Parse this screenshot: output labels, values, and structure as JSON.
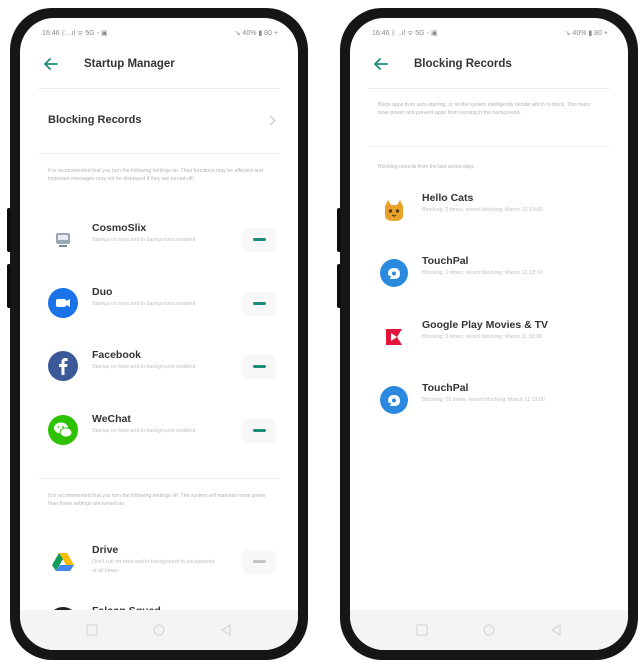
{
  "statusbar": {
    "left_text": "16:46 ᛒ ..ıl ᯤ 5G ◦ ▣",
    "right_text": "↘ 40% ▮ 80 +"
  },
  "left_screen": {
    "title": "Startup Manager",
    "blocking_records_label": "Blocking Records",
    "note_top": "It is recommended that you turn the following settings on. Their functions may be affected and important messages may not be displayed if they are turned off.",
    "apps_on": [
      {
        "name": "CosmoSlix",
        "desc": "Startup on boot and in background enabled"
      },
      {
        "name": "Duo",
        "desc": "Startup on boot and in background enabled"
      },
      {
        "name": "Facebook",
        "desc": "Startup on boot and in background enabled"
      },
      {
        "name": "WeChat",
        "desc": "Startup on boot and in background enabled"
      }
    ],
    "note_bottom": "It is recommended that you turn the following settings off. The system will maintain more power than these settings are turned on.",
    "apps_off": [
      {
        "name": "Drive",
        "desc": "Don't run on boot and in background in background at all times"
      },
      {
        "name": "Falcon Squad",
        "desc": ""
      }
    ]
  },
  "right_screen": {
    "title": "Blocking Records",
    "note": "Block apps from auto-starting, or let the system intelligently decide which to block. This helps save power and prevent apps from running in the background.",
    "section_label": "Blocking records from the last seven days",
    "records": [
      {
        "name": "Hello Cats",
        "desc": "Blocking: 2 times, recent blocking: March 12 13:00",
        "icon": "cat-icon"
      },
      {
        "name": "TouchPal",
        "desc": "Blocking: 1 times, recent blocking: March 12 13:10",
        "icon": "touchpal-icon"
      },
      {
        "name": "Google Play Movies & TV",
        "desc": "Blocking: 3 times, recent blocking: March 11 12:00",
        "icon": "play-movies-icon"
      },
      {
        "name": "TouchPal",
        "desc": "Blocking: 10 times, recent blocking: March 11 13:00",
        "icon": "touchpal-icon"
      }
    ]
  },
  "colors": {
    "accent": "#1c8c79",
    "text_primary": "#333333",
    "text_secondary": "#b4b4b4"
  }
}
